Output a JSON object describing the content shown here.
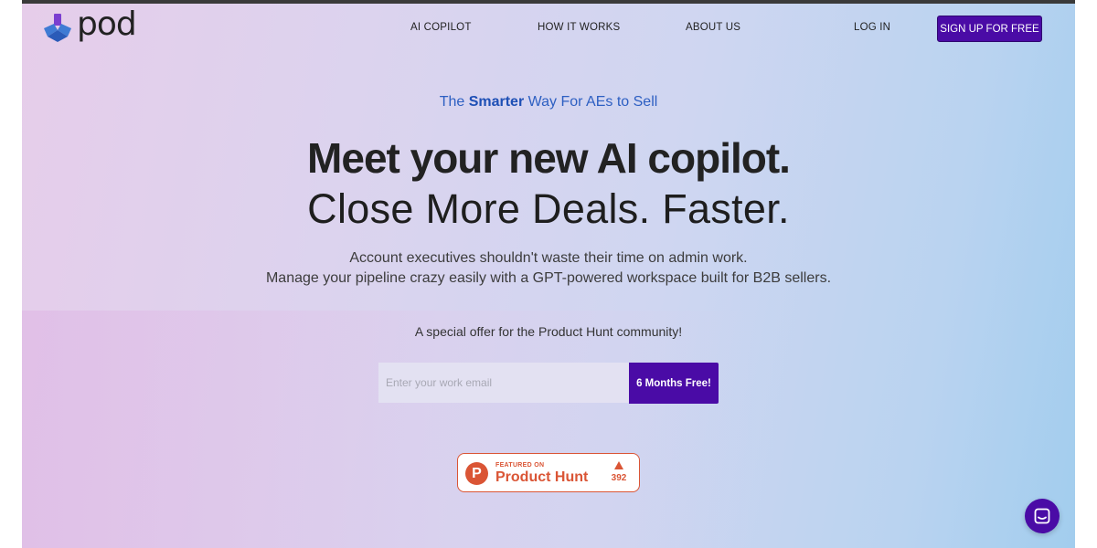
{
  "brand": {
    "name": "pod",
    "accent": "#4a0ba6",
    "logo_icon": "pod-logo-icon"
  },
  "nav": {
    "links": [
      {
        "label": "AI COPILOT"
      },
      {
        "label": "HOW IT WORKS"
      },
      {
        "label": "ABOUT US"
      }
    ],
    "login_label": "LOG IN",
    "signup_label": "SIGN UP FOR FREE"
  },
  "hero": {
    "tagline_pre": "The ",
    "tagline_bold": "Smarter",
    "tagline_post": " Way For AEs to Sell",
    "headline": "Meet your new AI copilot.",
    "subheadline": "Close More Deals. Faster.",
    "description_line1": "Account executives shouldn't waste their time on admin work.",
    "description_line2": "Manage your pipeline crazy easily with a GPT-powered workspace built for B2B sellers."
  },
  "offer": {
    "text": "A special offer for the Product Hunt community!",
    "email_placeholder": "Enter your work email",
    "email_value": "",
    "cta_label": "6 Months Free!"
  },
  "product_hunt": {
    "logo_letter": "P",
    "featured_label": "FEATURED ON",
    "name": "Product Hunt",
    "upvotes": "392",
    "color": "#da5535"
  },
  "chat": {
    "icon": "chat-icon"
  }
}
